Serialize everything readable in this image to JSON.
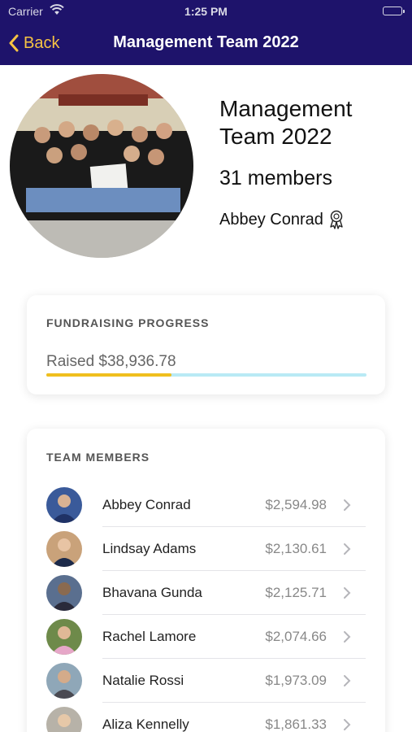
{
  "status_bar": {
    "carrier": "Carrier",
    "time": "1:25 PM"
  },
  "nav": {
    "back_label": "Back",
    "title": "Management Team 2022"
  },
  "team": {
    "name": "Management Team 2022",
    "members_text": "31 members",
    "captain": "Abbey Conrad"
  },
  "fundraising": {
    "heading": "FUNDRAISING PROGRESS",
    "raised_text": "Raised $38,936.78",
    "progress_fraction": 0.39
  },
  "members": {
    "heading": "TEAM MEMBERS",
    "list": [
      {
        "name": "Abbey Conrad",
        "amount": "$2,594.98"
      },
      {
        "name": "Lindsay Adams",
        "amount": "$2,130.61"
      },
      {
        "name": "Bhavana Gunda",
        "amount": "$2,125.71"
      },
      {
        "name": "Rachel Lamore",
        "amount": "$2,074.66"
      },
      {
        "name": "Natalie Rossi",
        "amount": "$1,973.09"
      },
      {
        "name": "Aliza Kennelly",
        "amount": "$1,861.33"
      }
    ]
  },
  "colors": {
    "nav": "#1e136b",
    "accent": "#f0bf1e",
    "track": "#b9eaf5"
  }
}
